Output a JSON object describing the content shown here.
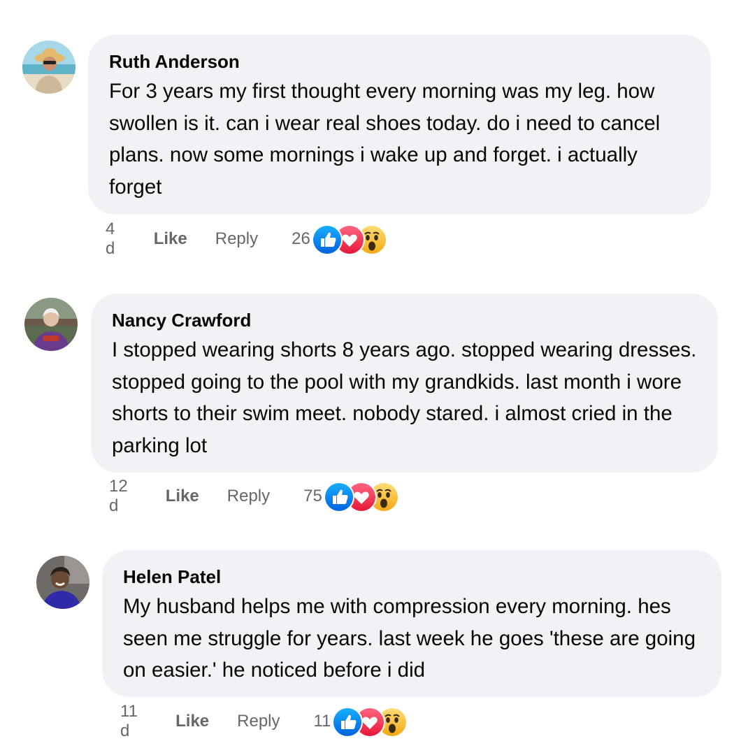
{
  "comments": [
    {
      "author": "Ruth Anderson",
      "text": "For 3 years my first thought every morning was my leg. how swollen is it. can i wear real shoes today. do i need to cancel plans. now some mornings i wake up and forget. i actually forget",
      "time": "4 d",
      "like_label": "Like",
      "reply_label": "Reply",
      "reaction_count": "26",
      "reactions": [
        "like-icon",
        "love-icon",
        "wow-icon"
      ]
    },
    {
      "author": "Nancy Crawford",
      "text": "I stopped wearing shorts 8 years ago. stopped wearing dresses. stopped going to the pool with my grandkids. last month i wore shorts to their swim meet. nobody stared. i almost cried in the parking lot",
      "time": "12 d",
      "like_label": "Like",
      "reply_label": "Reply",
      "reaction_count": "75",
      "reactions": [
        "like-icon",
        "love-icon",
        "wow-icon"
      ]
    },
    {
      "author": "Helen Patel",
      "text": "My husband helps me with compression every morning. hes seen me struggle for years. last week he goes 'these are going on easier.' he noticed before i did",
      "time": "11 d",
      "like_label": "Like",
      "reply_label": "Reply",
      "reaction_count": "11",
      "reactions": [
        "like-icon",
        "love-icon",
        "wow-icon"
      ]
    }
  ],
  "colors": {
    "bubble": "#f0f2f5",
    "secondary_text": "#65676b",
    "like_blue": "#1877f2",
    "love_red": "#f33e58",
    "wow_yellow": "#f7b125"
  }
}
